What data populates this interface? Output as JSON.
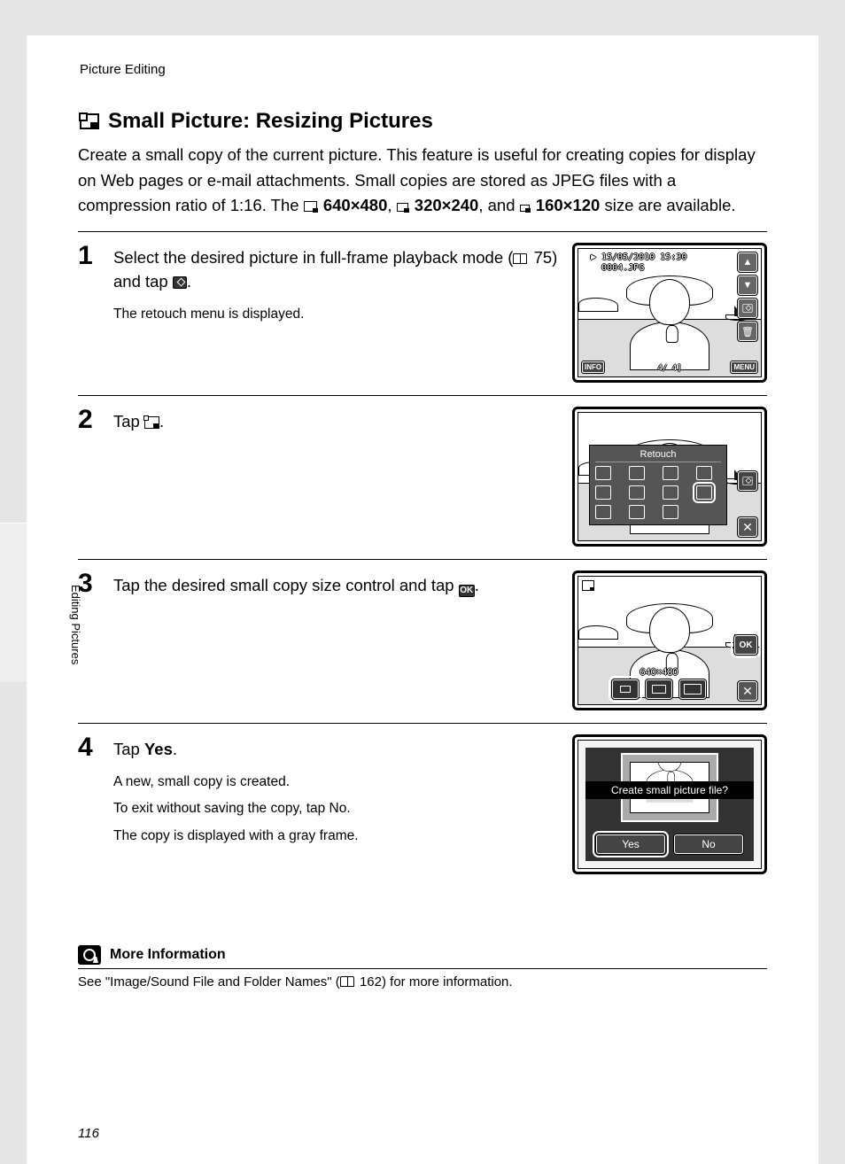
{
  "header": {
    "text": "Picture Editing"
  },
  "title": "Small Picture: Resizing Pictures",
  "intro": {
    "part1": "Create a small copy of the current picture. This feature is useful for creating copies for display on Web pages or e-mail attachments. Small copies are stored as JPEG files with a compression ratio of 1:16. The ",
    "size1": "640×480",
    "sep1": ", ",
    "size2": "320×240",
    "sep2": ", and ",
    "size3": "160×120",
    "part2": " size are available."
  },
  "steps": [
    {
      "num": "1",
      "instr_a": "Select the desired picture in full-frame playback mode (",
      "instr_ref": "75",
      "instr_b": ") and tap ",
      "instr_c": ".",
      "sub": [
        "The retouch menu is displayed."
      ]
    },
    {
      "num": "2",
      "instr_a": "Tap ",
      "instr_b": "."
    },
    {
      "num": "3",
      "instr_a": "Tap the desired small copy size control and tap ",
      "instr_b": "."
    },
    {
      "num": "4",
      "instr_a": "Tap ",
      "instr_bold": "Yes",
      "instr_b": ".",
      "sub": [
        "A new, small copy is created.",
        "To exit without saving the copy, tap ",
        "No",
        ".",
        "The copy is displayed with a gray frame."
      ]
    }
  ],
  "screens": {
    "s1": {
      "date": "15/05/2010 15:30",
      "file": "0004.JPG",
      "counter": "4/    4]",
      "info": "INFO",
      "menu": "MENU"
    },
    "s2": {
      "title": "Retouch"
    },
    "s3": {
      "size_label": "640×480",
      "ok": "OK"
    },
    "s4": {
      "prompt": "Create small picture file?",
      "yes": "Yes",
      "no": "No"
    }
  },
  "more_info": {
    "title": "More Information",
    "body_a": "See \"Image/Sound File and Folder Names\" (",
    "body_ref": "162",
    "body_b": ") for more information."
  },
  "side_tab": "Editing Pictures",
  "page_number": "116"
}
